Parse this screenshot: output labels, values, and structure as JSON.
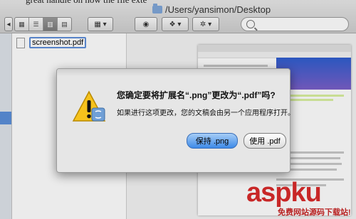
{
  "window": {
    "partial_text": "great handle on how the file exte",
    "title": "/Users/yansimon/Desktop",
    "view_buttons": [
      "icon",
      "list",
      "column",
      "cover-flow"
    ],
    "selected_view": 2
  },
  "file": {
    "name": "screenshot.pdf"
  },
  "dialog": {
    "message": "您确定要将扩展名“.png”更改为“.pdf”吗?",
    "info": "如果进行这项更改，您的文稿会由另一个应用程序打开。",
    "keep_label": "保持 .png",
    "use_label": "使用 .pdf"
  },
  "watermark": {
    "text": "aspku",
    "subtext": "免费网站源码下载站!"
  },
  "colors": {
    "accent": "#3d8ae8",
    "selection": "#5b8fd9",
    "watermark": "#d92b2b"
  }
}
